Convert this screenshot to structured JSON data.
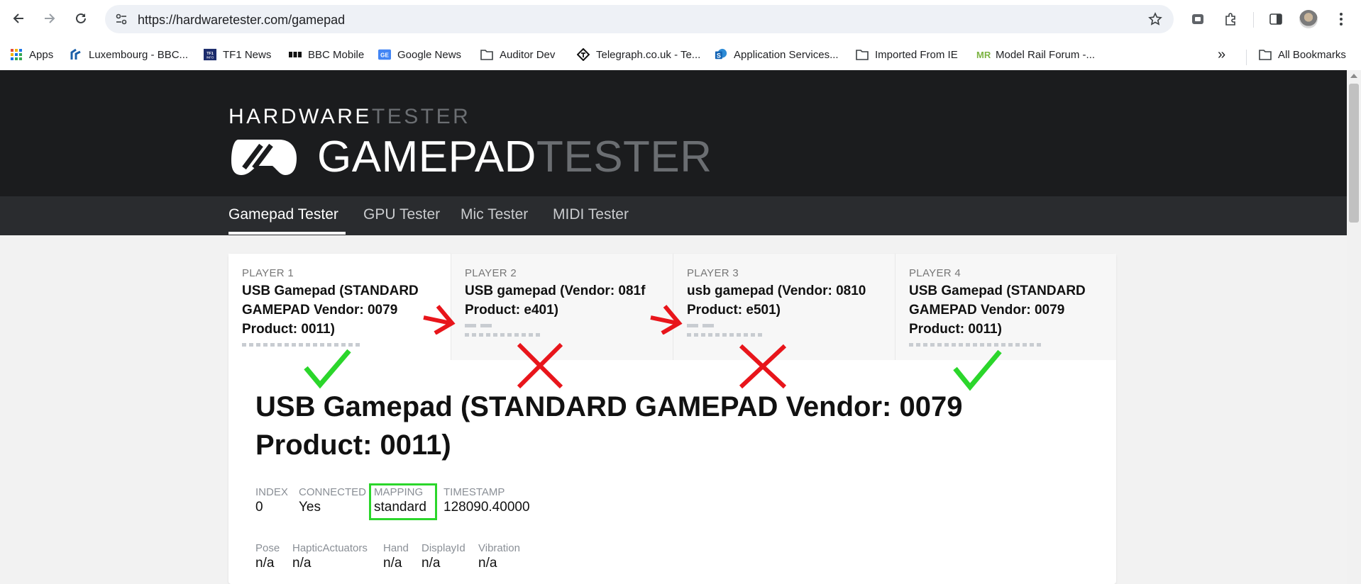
{
  "browser": {
    "url": "https://hardwaretester.com/gamepad",
    "icons": [
      "back-icon",
      "forward-icon",
      "reload-icon",
      "site-info-icon",
      "star-icon",
      "extension-icon",
      "puzzle-icon",
      "side-panel-icon",
      "profile-avatar",
      "more-icon"
    ],
    "bookmarks": [
      {
        "label": "Apps",
        "icon": "apps-grid-icon"
      },
      {
        "label": "Luxembourg - BBC...",
        "icon": "bbc-favicon"
      },
      {
        "label": "TF1 News",
        "icon": "tf1-favicon"
      },
      {
        "label": "BBC Mobile",
        "icon": "bbc-mobile-favicon"
      },
      {
        "label": "Google News",
        "icon": "google-news-favicon"
      },
      {
        "label": "Auditor Dev",
        "icon": "folder-icon"
      },
      {
        "label": "Telegraph.co.uk - Te...",
        "icon": "telegraph-favicon"
      },
      {
        "label": "Application Services...",
        "icon": "sharepoint-favicon"
      },
      {
        "label": "Imported From IE",
        "icon": "folder-icon"
      },
      {
        "label": "Model Rail Forum -...",
        "icon": "mr-favicon"
      }
    ],
    "more_bookmarks": "»",
    "all_bookmarks": "All Bookmarks"
  },
  "site": {
    "brand_small_a": "HARDWARE",
    "brand_small_b": "TESTER",
    "brand_big_a": "GAMEPAD",
    "brand_big_b": "TESTER",
    "nav": [
      "Gamepad Tester",
      "GPU Tester",
      "Mic Tester",
      "MIDI Tester"
    ],
    "active_nav": "Gamepad Tester"
  },
  "players": [
    {
      "label": "PLAYER 1",
      "name": "USB Gamepad (STANDARD GAMEPAD Vendor: 0079 Product: 0011)",
      "annotation": "green-check"
    },
    {
      "label": "PLAYER 2",
      "name": "USB gamepad (Vendor: 081f Product: e401)",
      "annotation": "red-cross"
    },
    {
      "label": "PLAYER 3",
      "name": "usb gamepad (Vendor: 0810 Product: e501)",
      "annotation": "red-cross"
    },
    {
      "label": "PLAYER 4",
      "name": "USB Gamepad (STANDARD GAMEPAD Vendor: 0079 Product: 0011)",
      "annotation": "green-check"
    }
  ],
  "detail": {
    "title": "USB Gamepad (STANDARD GAMEPAD Vendor: 0079 Product: 0011)",
    "row1": [
      {
        "key": "INDEX",
        "value": "0"
      },
      {
        "key": "CONNECTED",
        "value": "Yes"
      },
      {
        "key": "MAPPING",
        "value": "standard"
      },
      {
        "key": "TIMESTAMP",
        "value": "128090.40000"
      }
    ],
    "row2": [
      {
        "key": "Pose",
        "value": "n/a"
      },
      {
        "key": "HapticActuators",
        "value": "n/a"
      },
      {
        "key": "Hand",
        "value": "n/a"
      },
      {
        "key": "DisplayId",
        "value": "n/a"
      },
      {
        "key": "Vibration",
        "value": "n/a"
      }
    ]
  },
  "colors": {
    "header_bg": "#1b1c1e",
    "nav_bg": "#2a2c2f",
    "annotation_green": "#2bd62b",
    "annotation_red": "#e8151b"
  }
}
